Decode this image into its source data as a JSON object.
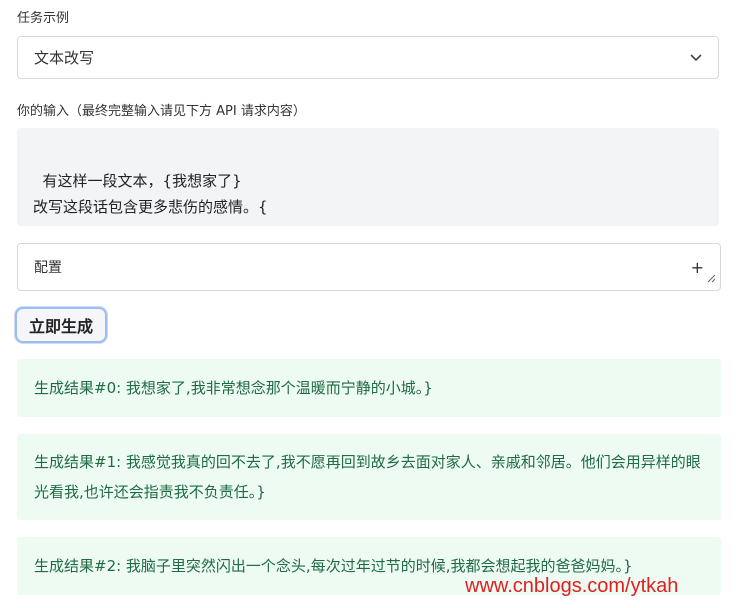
{
  "task_example": {
    "label": "任务示例",
    "selected": "文本改写"
  },
  "input": {
    "label": "你的输入（最终完整输入请见下方 API 请求内容）",
    "value": "有这样一段文本，{我想家了}\n改写这段话包含更多悲伤的感情。{"
  },
  "config": {
    "label": "配置",
    "expand_symbol": "+"
  },
  "generate_button": "立即生成",
  "results": [
    "生成结果#0: 我想家了,我非常想念那个温暖而宁静的小城。}",
    "生成结果#1: 我感觉我真的回不去了,我不愿再回到故乡去面对家人、亲戚和邻居。他们会用异样的眼光看我,也许还会指责我不负责任。}",
    "生成结果#2: 我脑子里突然闪出一个念头,每次过年过节的时候,我都会想起我的爸爸妈妈。}"
  ],
  "watermark": "www.cnblogs.com/ytkah"
}
